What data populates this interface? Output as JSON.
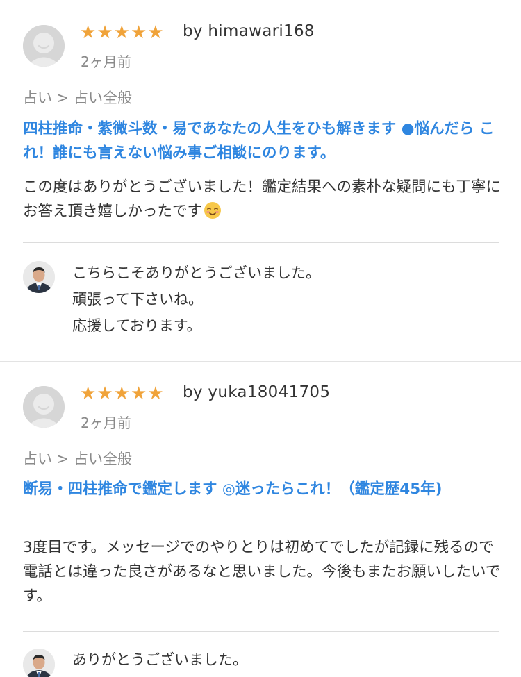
{
  "reviews": [
    {
      "rating": 5,
      "reviewer": "by himawari168",
      "date": "2ヶ月前",
      "breadcrumb": "占い > 占い全般",
      "title": "四柱推命・紫微斗数・易であなたの人生をひも解きます ●悩んだら これ！誰にも言えない悩み事ご相談にのります。",
      "body": "この度はありがとうございました！鑑定結果への素朴な疑問にも丁寧にお答え頂き嬉しかったです",
      "body_emoji": "smiling-face-icon",
      "reply_lines": [
        "こちらこそありがとうございました。",
        "頑張って下さいね。",
        "応援しております。"
      ]
    },
    {
      "rating": 5,
      "reviewer": "by yuka18041705",
      "date": "2ヶ月前",
      "breadcrumb": "占い > 占い全般",
      "title": "断易・四柱推命で鑑定します ◎迷ったらこれ！（鑑定歴45年)",
      "body": "3度目です。メッセージでのやりとりは初めてでしたが記録に残るので電話とは違った良さがあるなと思いました。今後もまたお願いしたいです。",
      "reply_lines": [
        "ありがとうございました。"
      ]
    }
  ],
  "colors": {
    "star": "#f0a33a",
    "title_link": "#2f86e0",
    "muted_text": "#8a8a8a",
    "divider": "#e3e3e3"
  }
}
